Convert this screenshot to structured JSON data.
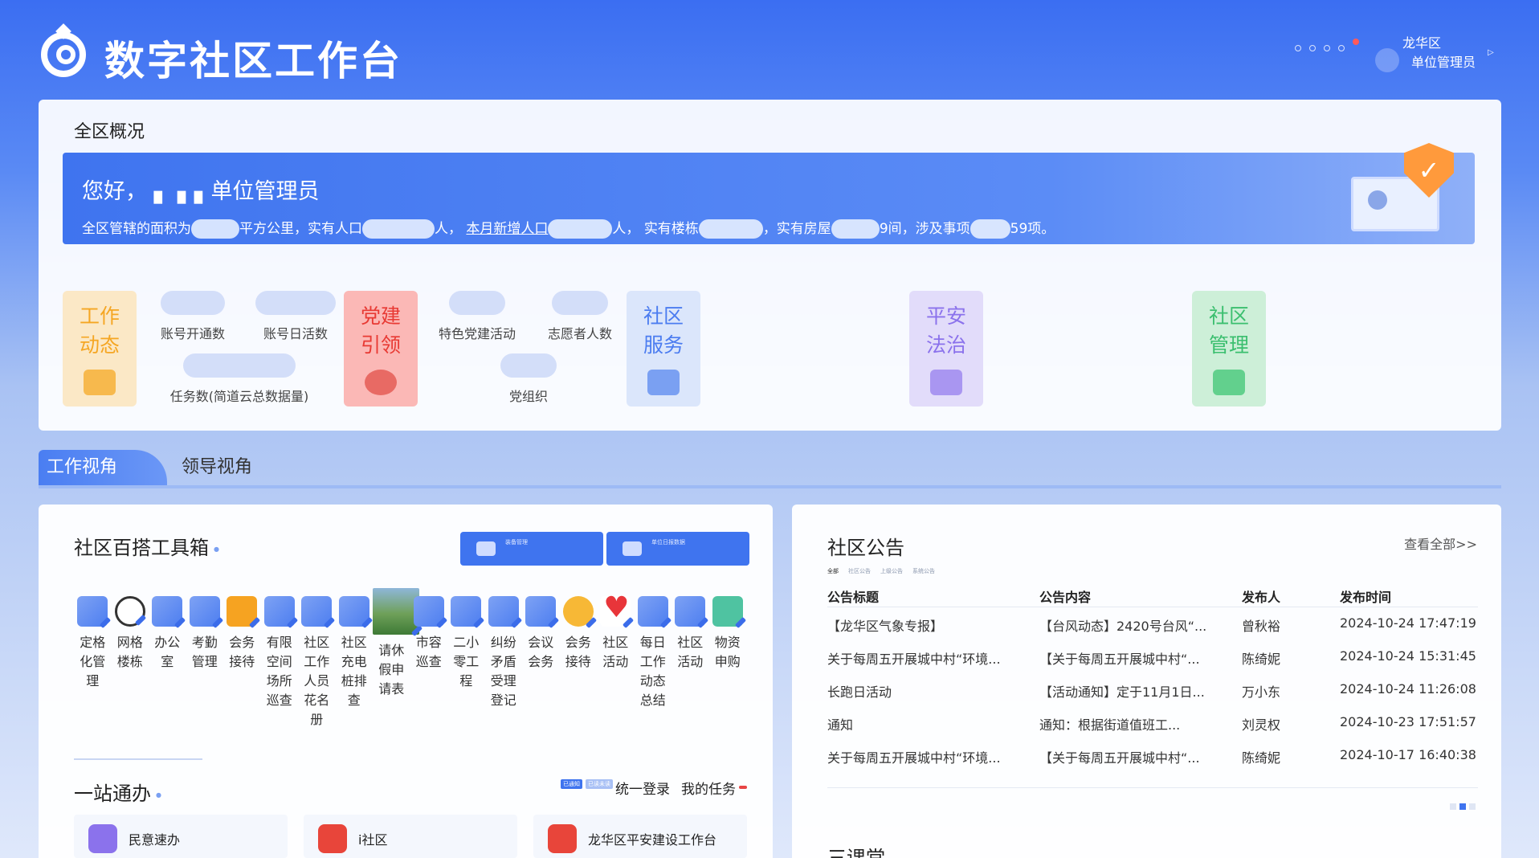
{
  "header": {
    "app_title": "数字社区工作台",
    "district": "龙华区",
    "role": "单位管理员",
    "icons": [
      "logo-icon",
      "bell-icon",
      "settings-icon",
      "avatar-icon"
    ]
  },
  "overview": {
    "title": "全区概况",
    "greeting": "您好， ▖ ▖▖单位管理员",
    "stats": {
      "area_prefix": "全区管辖的面积为",
      "area_unit": "平方公里，实有人口",
      "pop_unit": "人，",
      "new_pop_label": "本月新增人口",
      "new_pop_unit": "人，",
      "building_label": "实有楼栋",
      "house_label": "，实有房屋",
      "house_unit": "9间，涉及事项",
      "items_unit": "59项。"
    },
    "cards": [
      {
        "label": "工作动态",
        "color": "#f5a623"
      },
      {
        "label": "党建引领",
        "color": "#e83a34"
      },
      {
        "label": "社区服务",
        "color": "#4b7cf0"
      },
      {
        "label": "平安法治",
        "color": "#8b72ec"
      },
      {
        "label": "社区管理",
        "color": "#3bbf6f"
      }
    ],
    "metrics": {
      "accounts_opened": "账号开通数",
      "daily_active": "账号日活数",
      "tasks": "任务数(简道云总数据量)",
      "party_activity": "特色党建活动",
      "volunteers": "志愿者人数",
      "party_org": "党组织"
    }
  },
  "tabs": {
    "work": "工作视角",
    "leader": "领导视角"
  },
  "toolbox": {
    "title": "社区百搭工具箱",
    "quick_buttons": [
      "装备管理",
      "单位日报数据"
    ],
    "tools": [
      "定格化管理",
      "网格楼栋",
      "办公室",
      "考勤管理",
      "会务接待",
      "有限空间场所巡查",
      "社区工作人员花名册",
      "社区充电桩排查",
      "请休假申请表",
      "市容巡查",
      "二小零工程",
      "纠纷矛盾受理登记",
      "会议会务",
      "会务接待",
      "社区活动",
      "每日工作动态总结",
      "社区活动",
      "物资申购"
    ]
  },
  "one_stop": {
    "title": "一站通办",
    "tags": [
      "已通知",
      "已读未读"
    ],
    "login": "统一登录",
    "my_tasks": "我的任务",
    "apps": [
      {
        "label": "民意速办",
        "color": "#8b72ec"
      },
      {
        "label": "i社区",
        "color": "#e8453a"
      },
      {
        "label": "龙华区平安建设工作台",
        "color": "#e8453a"
      }
    ]
  },
  "notices": {
    "title": "社区公告",
    "view_all": "查看全部>>",
    "subtabs": [
      "全部",
      "社区公告",
      "上级公告",
      "系统公告"
    ],
    "columns": [
      "公告标题",
      "公告内容",
      "发布人",
      "发布时间"
    ],
    "rows": [
      [
        "【龙华区气象专报】",
        "【台风动态】2420号台风“...",
        "曾秋裕",
        "2024-10-24 17:47:19"
      ],
      [
        "关于每周五开展城中村“环境...",
        "【关于每周五开展城中村“...",
        "陈绮妮",
        "2024-10-24 15:31:45"
      ],
      [
        "长跑日活动",
        "【活动通知】定于11月1日...",
        "万小东",
        "2024-10-24 11:26:08"
      ],
      [
        "通知",
        "通知：根据街道值班工...",
        "刘灵权",
        "2024-10-23 17:51:57"
      ],
      [
        "关于每周五开展城中村“环境...",
        "【关于每周五开展城中村“...",
        "陈绮妮",
        "2024-10-17 16:40:38"
      ]
    ],
    "next_section": "三课堂"
  }
}
